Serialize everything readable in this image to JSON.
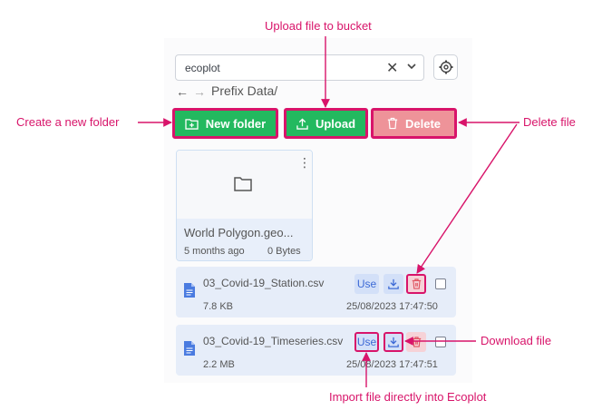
{
  "bucket_select": {
    "value": "ecoplot",
    "clear_icon": "close-icon",
    "chevron_icon": "chevron-down-icon"
  },
  "settings_icon": "gear-icon",
  "breadcrumb": {
    "back_glyph": "←",
    "forward_glyph": "→",
    "path": "Prefix Data/"
  },
  "toolbar": {
    "new_folder_label": "New folder",
    "upload_label": "Upload",
    "delete_label": "Delete"
  },
  "folder": {
    "name": "World Polygon.geo...",
    "modified": "5 months ago",
    "size": "0 Bytes"
  },
  "files": [
    {
      "name": "03_Covid-19_Station.csv",
      "size": "7.8 KB",
      "date": "25/08/2023 17:47:50",
      "use_label": "Use"
    },
    {
      "name": "03_Covid-19_Timeseries.csv",
      "size": "2.2 MB",
      "date": "25/08/2023 17:47:51",
      "use_label": "Use"
    }
  ],
  "annotations": {
    "upload": "Upload file to bucket",
    "new_folder": "Create a new folder",
    "delete": "Delete file",
    "download": "Download file",
    "import": "Import file directly into Ecoplot"
  },
  "colors": {
    "accent_annotation": "#d8146a",
    "primary_green": "#23b95f",
    "delete_red": "#ee9399",
    "link_blue": "#3d6ad6"
  }
}
